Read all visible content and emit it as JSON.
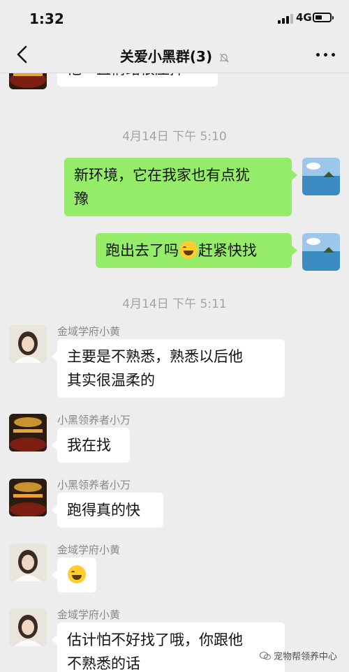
{
  "status_bar": {
    "time": "1:32",
    "network": "4G"
  },
  "nav": {
    "title": "关爱小黑群(3)"
  },
  "messages": [
    {
      "text": "他一直情绪很压抑"
    },
    {
      "timestamp": "4月14日 下午 5:10"
    },
    {
      "text": "新环境，它在我家也有点犹\n豫"
    },
    {
      "text_before": "跑出去了吗",
      "emoji": "laughing-tears-emoji",
      "text_after": "赶紧快找"
    },
    {
      "timestamp": "4月14日 下午 5:11"
    },
    {
      "sender": "金域学府小黄",
      "text": "主要是不熟悉，熟悉以后他\n其实很温柔的"
    },
    {
      "sender": "小黑领养者小万",
      "text": "我在找"
    },
    {
      "sender": "小黑领养者小万",
      "text": "跑得真的快"
    },
    {
      "sender": "金域学府小黄",
      "emoji": "laughing-tears-emoji"
    },
    {
      "sender": "金域学府小黄",
      "text": "估计怕不好找了哦，你跟他\n不熟悉的话"
    }
  ],
  "watermark": "宠物帮领养中心",
  "colors": {
    "outgoing_bubble": "#95ec69",
    "incoming_bubble": "#ffffff",
    "background": "#ededed"
  }
}
